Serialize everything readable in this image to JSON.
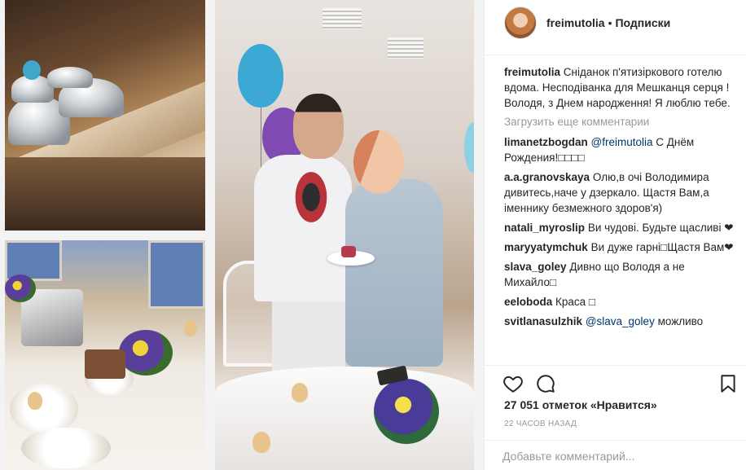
{
  "header": {
    "username": "freimutolia",
    "separator": "•",
    "follow_label": "Подписки"
  },
  "post": {
    "caption_user": "freimutolia",
    "caption_text": "Сніданок п'ятизіркового готелю вдома. Несподіванка для Мешканця серця ! Володя, з Днем народження! Я люблю тебе.",
    "load_more_label": "Загрузить еще комментарии",
    "comments": [
      {
        "user": "limanetzbogdan",
        "mention": "@freimutolia",
        "text": " С Днём Рождения!□□□□"
      },
      {
        "user": "a.a.granovskaya",
        "mention": "",
        "text": "Олю,в очі Володимира дивитесь,наче у дзеркало. Щастя Вам,а іменнику безмежного здоров'я)"
      },
      {
        "user": "natali_myroslip",
        "mention": "",
        "text": "Ви чудові. Будьте щасливі ❤"
      },
      {
        "user": "maryyatymchuk",
        "mention": "",
        "text": "Ви дуже гарні□Щастя Вам❤"
      },
      {
        "user": "slava_goley",
        "mention": "",
        "text": "Дивно що Володя а не Михайло□"
      },
      {
        "user": "eeloboda",
        "mention": "",
        "text": "Краса □"
      },
      {
        "user": "svitlanasulzhik",
        "mention": "@slava_goley",
        "text": " можливо"
      }
    ],
    "likes_text": "27 051 отметок «Нравится»",
    "time_text": "22 часов назад",
    "add_comment_placeholder": "Добавьте комментарий..."
  },
  "icons": {
    "like": "heart-outline-icon",
    "comment": "speech-bubble-icon",
    "save": "bookmark-icon"
  },
  "colors": {
    "text": "#262626",
    "muted": "#999999",
    "mention": "#003569",
    "border": "#efefef"
  }
}
